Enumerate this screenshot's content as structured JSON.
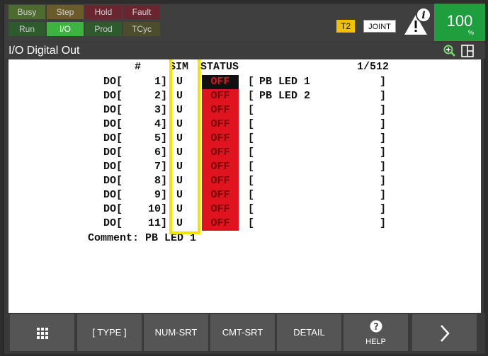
{
  "status_leds": {
    "busy": "Busy",
    "step": "Step",
    "hold": "Hold",
    "fault": "Fault",
    "run": "Run",
    "io": "I/O",
    "prod": "Prod",
    "tcyc": "TCyc"
  },
  "status_right": {
    "mode": "T2",
    "coord": "JOINT",
    "override": "100",
    "override_unit": "%"
  },
  "title": "I/O Digital Out",
  "table": {
    "hdr_num": "#",
    "hdr_sim": "SIM",
    "hdr_status": "STATUS",
    "page": "1/512",
    "rows": [
      {
        "prefix": "DO[",
        "num": "1]",
        "sim": "U",
        "status": "OFF",
        "lbr": "[",
        "comment": "PB LED 1",
        "rbr": "]"
      },
      {
        "prefix": "DO[",
        "num": "2]",
        "sim": "U",
        "status": "OFF",
        "lbr": "[",
        "comment": "PB LED 2",
        "rbr": "]"
      },
      {
        "prefix": "DO[",
        "num": "3]",
        "sim": "U",
        "status": "OFF",
        "lbr": "[",
        "comment": "",
        "rbr": "]"
      },
      {
        "prefix": "DO[",
        "num": "4]",
        "sim": "U",
        "status": "OFF",
        "lbr": "[",
        "comment": "",
        "rbr": "]"
      },
      {
        "prefix": "DO[",
        "num": "5]",
        "sim": "U",
        "status": "OFF",
        "lbr": "[",
        "comment": "",
        "rbr": "]"
      },
      {
        "prefix": "DO[",
        "num": "6]",
        "sim": "U",
        "status": "OFF",
        "lbr": "[",
        "comment": "",
        "rbr": "]"
      },
      {
        "prefix": "DO[",
        "num": "7]",
        "sim": "U",
        "status": "OFF",
        "lbr": "[",
        "comment": "",
        "rbr": "]"
      },
      {
        "prefix": "DO[",
        "num": "8]",
        "sim": "U",
        "status": "OFF",
        "lbr": "[",
        "comment": "",
        "rbr": "]"
      },
      {
        "prefix": "DO[",
        "num": "9]",
        "sim": "U",
        "status": "OFF",
        "lbr": "[",
        "comment": "",
        "rbr": "]"
      },
      {
        "prefix": "DO[",
        "num": "10]",
        "sim": "U",
        "status": "OFF",
        "lbr": "[",
        "comment": "",
        "rbr": "]"
      },
      {
        "prefix": "DO[",
        "num": "11]",
        "sim": "U",
        "status": "OFF",
        "lbr": "[",
        "comment": "",
        "rbr": "]"
      }
    ],
    "comment_line": "Comment: PB LED 1"
  },
  "function_keys": {
    "type": "[ TYPE ]",
    "numsrt": "NUM-SRT",
    "cmtsrt": "CMT-SRT",
    "detail": "DETAIL",
    "help": "HELP"
  },
  "icons": {
    "menu": "grid-menu-icon",
    "help": "question-icon",
    "next": "chevron-right-icon",
    "zoom": "zoom-in-icon",
    "split": "split-screen-icon",
    "warn": "warning-info-icon"
  },
  "colors": {
    "status_off": "#e0141e",
    "highlight": "#f4e400",
    "override": "#1f9e3e",
    "io_active": "#3fb33f"
  }
}
